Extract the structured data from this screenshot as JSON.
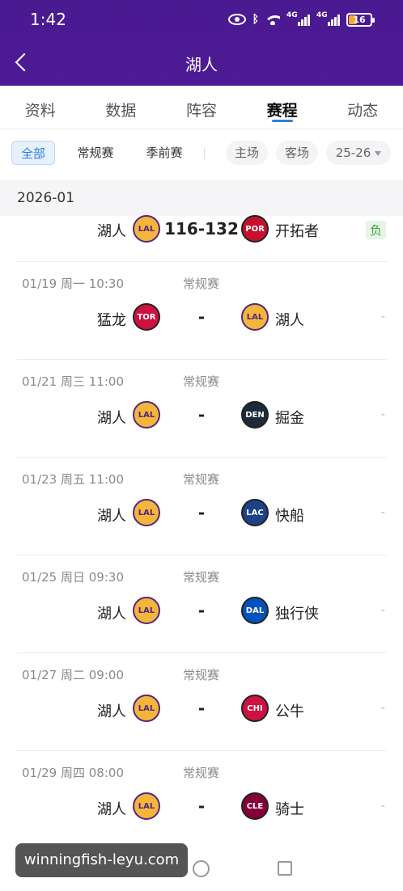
{
  "status_bar": {
    "time": "1:42",
    "signal1": "4G",
    "signal2": "4G",
    "battery": "16"
  },
  "header": {
    "title": "湖人"
  },
  "tabs": [
    {
      "label": "资料"
    },
    {
      "label": "数据"
    },
    {
      "label": "阵容"
    },
    {
      "label": "赛程",
      "active": true
    },
    {
      "label": "动态"
    }
  ],
  "filters": {
    "all": "全部",
    "regular": "常规赛",
    "preseason": "季前赛",
    "home": "主场",
    "away": "客场",
    "season": "25-26"
  },
  "month_header": "2026-01",
  "games": [
    {
      "home": "湖人",
      "home_abbr": "LAL",
      "away": "开拓者",
      "away_abbr": "POR",
      "score": "116-132",
      "result": "负"
    },
    {
      "date": "01/19  周一 10:30",
      "type": "常规赛",
      "home": "猛龙",
      "home_abbr": "TOR",
      "away": "湖人",
      "away_abbr": "LAL",
      "score": "-",
      "result": "-"
    },
    {
      "date": "01/21  周三 11:00",
      "type": "常规赛",
      "home": "湖人",
      "home_abbr": "LAL",
      "away": "掘金",
      "away_abbr": "DEN",
      "score": "-",
      "result": "-"
    },
    {
      "date": "01/23  周五 11:00",
      "type": "常规赛",
      "home": "湖人",
      "home_abbr": "LAL",
      "away": "快船",
      "away_abbr": "LAC",
      "score": "-",
      "result": "-"
    },
    {
      "date": "01/25  周日 09:30",
      "type": "常规赛",
      "home": "湖人",
      "home_abbr": "LAL",
      "away": "独行侠",
      "away_abbr": "DAL",
      "score": "-",
      "result": "-"
    },
    {
      "date": "01/27  周二 09:00",
      "type": "常规赛",
      "home": "湖人",
      "home_abbr": "LAL",
      "away": "公牛",
      "away_abbr": "CHI",
      "score": "-",
      "result": "-"
    },
    {
      "date": "01/29  周四 08:00",
      "type": "常规赛",
      "home": "湖人",
      "home_abbr": "LAL",
      "away": "骑士",
      "away_abbr": "CLE",
      "score": "-",
      "result": "-"
    }
  ],
  "colors": {
    "header_bg": "#4c1b94",
    "accent": "#2f7fd8",
    "LAL": "#f4b63a",
    "POR": "#c8102e",
    "TOR": "#ce1141",
    "DEN": "#1d2a3a",
    "LAC": "#1d428a",
    "DAL": "#0053bc",
    "CHI": "#ce1141",
    "CLE": "#860038"
  },
  "watermark": "winningfish-leyu.com"
}
